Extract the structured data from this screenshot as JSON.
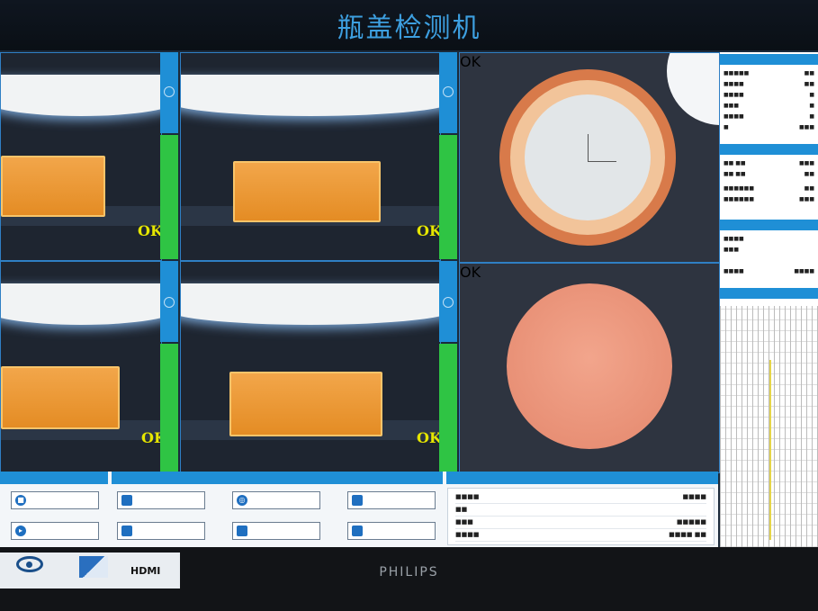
{
  "app": {
    "title": "瓶盖检测机"
  },
  "cameras": {
    "ok_label": "OK"
  },
  "bezel": {
    "brand": "PHILIPS",
    "hdmi": "HDMI"
  }
}
